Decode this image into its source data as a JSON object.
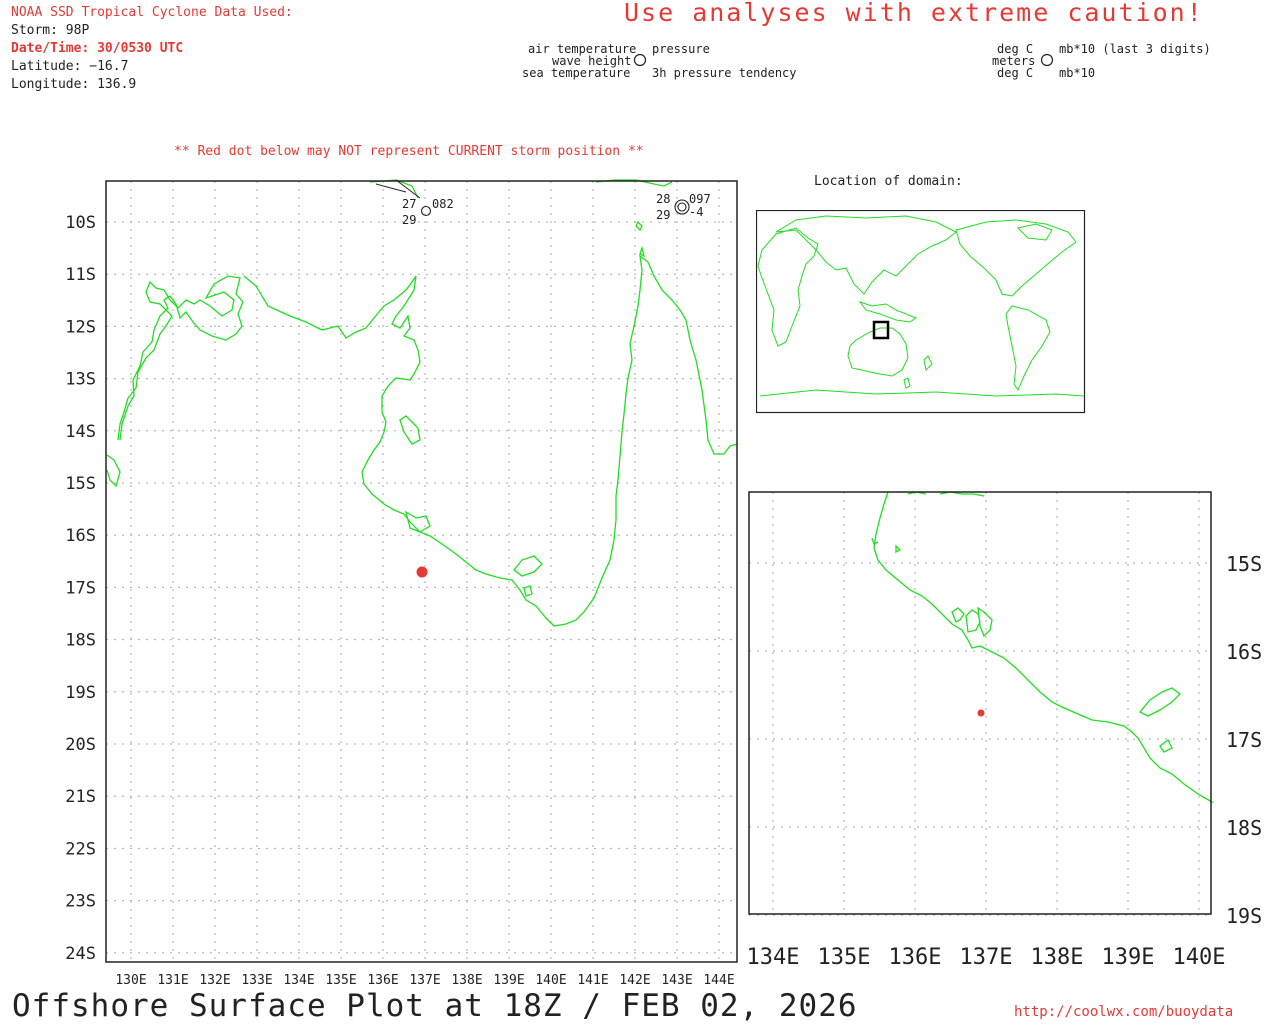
{
  "header": {
    "source": "NOAA SSD Tropical Cyclone Data Used:",
    "storm": "Storm: 98P",
    "datetime": "Date/Time: 30/0530 UTC",
    "latitude": "Latitude: −16.7",
    "longitude": "Longitude: 136.9",
    "caution": "Use analyses with extreme caution!",
    "red_dot_note": "** Red dot below may NOT represent CURRENT storm position **"
  },
  "legend": {
    "air_temperature": "air temperature",
    "wave_height": "wave height",
    "sea_temperature": "sea temperature",
    "pressure": "pressure",
    "pressure_tendency": "3h pressure tendency",
    "deg_c_top": "deg C",
    "meters": "meters",
    "deg_c_bottom": "deg C",
    "mb_top": "mb*10 (last 3 digits)",
    "mb_bottom": "mb*10"
  },
  "main_map": {
    "lat_labels": [
      "10S",
      "11S",
      "12S",
      "13S",
      "14S",
      "15S",
      "16S",
      "17S",
      "18S",
      "19S",
      "20S",
      "21S",
      "22S",
      "23S",
      "24S"
    ],
    "lon_labels": [
      "130E",
      "131E",
      "132E",
      "133E",
      "134E",
      "135E",
      "136E",
      "137E",
      "138E",
      "139E",
      "140E",
      "141E",
      "142E",
      "143E",
      "144E"
    ],
    "storm_position": {
      "lat": -16.7,
      "lon": 136.9
    },
    "stations": [
      {
        "air_temp": "27",
        "sea_temp": "29",
        "pressure": "082",
        "tendency": ""
      },
      {
        "air_temp": "28",
        "sea_temp": "29",
        "pressure": "097",
        "tendency": "-4"
      }
    ]
  },
  "inset_globe": {
    "title": "Location of domain:"
  },
  "zoom_map": {
    "lat_labels": [
      "15S",
      "16S",
      "17S",
      "18S",
      "19S"
    ],
    "lon_labels": [
      "134E",
      "135E",
      "136E",
      "137E",
      "138E",
      "139E",
      "140E"
    ]
  },
  "footer": {
    "title": "Offshore Surface Plot at 18Z / FEB 02, 2026",
    "url": "http://coolwx.com/buoydata"
  },
  "colors": {
    "coastline": "#22dd22",
    "storm_dot": "#e53935",
    "text_red": "#e53935"
  }
}
